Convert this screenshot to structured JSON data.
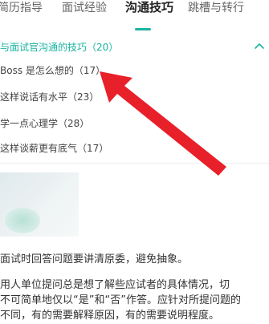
{
  "colors": {
    "accent": "#1bb3a0",
    "arrow": "#e8202a"
  },
  "tabs": [
    {
      "label": "简历指导",
      "active": false
    },
    {
      "label": "面试经验",
      "active": false
    },
    {
      "label": "沟通技巧",
      "active": true
    },
    {
      "label": "跳槽与转行",
      "active": false
    }
  ],
  "section": {
    "title": "与面试官沟通的技巧（20）",
    "toggle_icon": "chevron-up-icon"
  },
  "faq_items": [
    {
      "label": "Boss 是怎么想的（17）"
    },
    {
      "label": "这样说话有水平（23）"
    },
    {
      "label": "学一点心理学（28）"
    },
    {
      "label": "这样谈薪更有底气（17）"
    }
  ],
  "article": {
    "intro": "面试时回答问题要讲清原委，避免抽象。",
    "body_lines": [
      "用人单位提问总是想了解些应试者的具体情况，切",
      "不可简单地仅以“是”和“否”作答。应针对所提问题的",
      "不同，有的需要解释原因，有的需要说明程度。"
    ]
  }
}
